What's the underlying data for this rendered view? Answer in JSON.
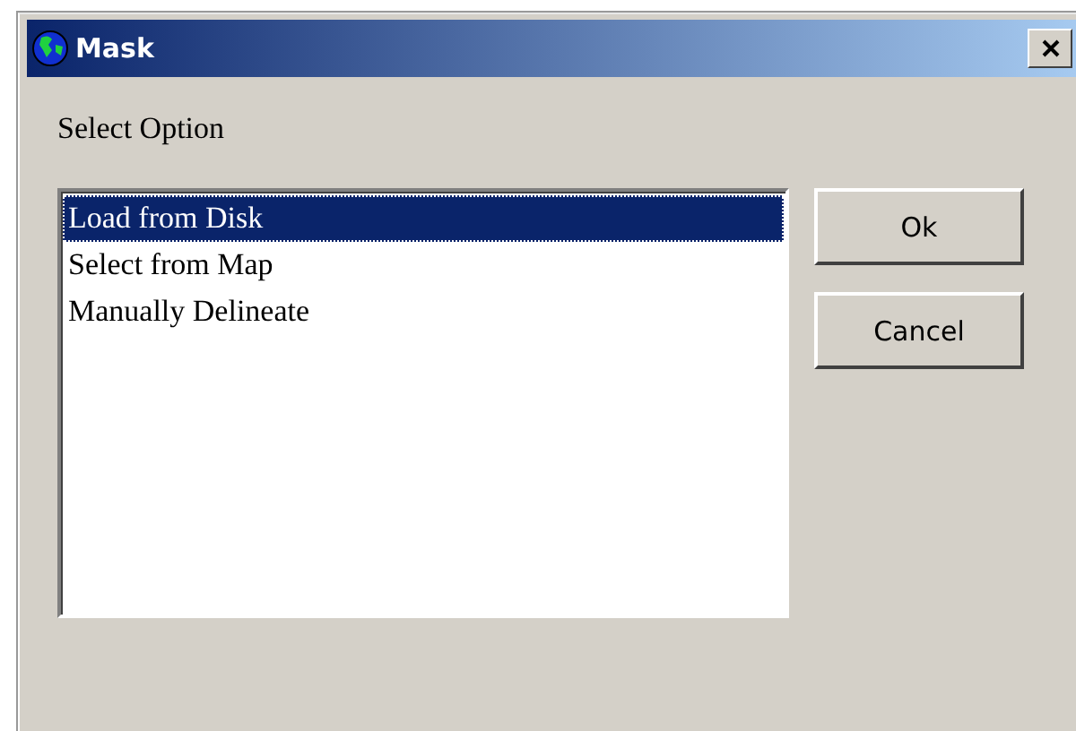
{
  "window": {
    "title": "Mask"
  },
  "prompt": "Select Option",
  "options": [
    {
      "label": "Load from Disk",
      "selected": true
    },
    {
      "label": "Select from Map",
      "selected": false
    },
    {
      "label": "Manually Delineate",
      "selected": false
    }
  ],
  "buttons": [
    "Ok",
    "Cancel"
  ]
}
